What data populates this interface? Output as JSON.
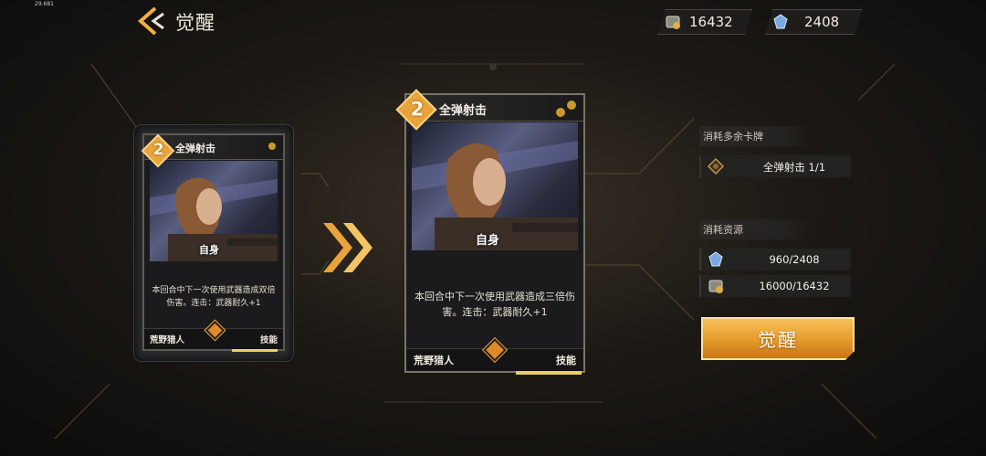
{
  "fps": "29.681",
  "header": {
    "title": "觉醒"
  },
  "resources": {
    "gold": "16432",
    "crystal": "2408"
  },
  "card_before": {
    "cost": "2",
    "name": "全弹射击",
    "self_tag": "自身",
    "description": "本回合中下一次使用武器造成双倍伤害。连击：武器耐久+1",
    "class": "荒野猎人",
    "type": "技能"
  },
  "card_after": {
    "cost": "2",
    "name": "全弹射击",
    "self_tag": "自身",
    "description": "本回合中下一次使用武器造成三倍伤害。连击：武器耐久+1",
    "class": "荒野猎人",
    "type": "技能"
  },
  "consume_cards": {
    "label": "消耗多余卡牌",
    "item": "全弹射击 1/1"
  },
  "consume_resources": {
    "label": "消耗资源",
    "crystal": "960/2408",
    "gold": "16000/16432"
  },
  "awaken_button": "觉醒",
  "colors": {
    "accent": "#e8a43a",
    "button": "#f0b040"
  }
}
